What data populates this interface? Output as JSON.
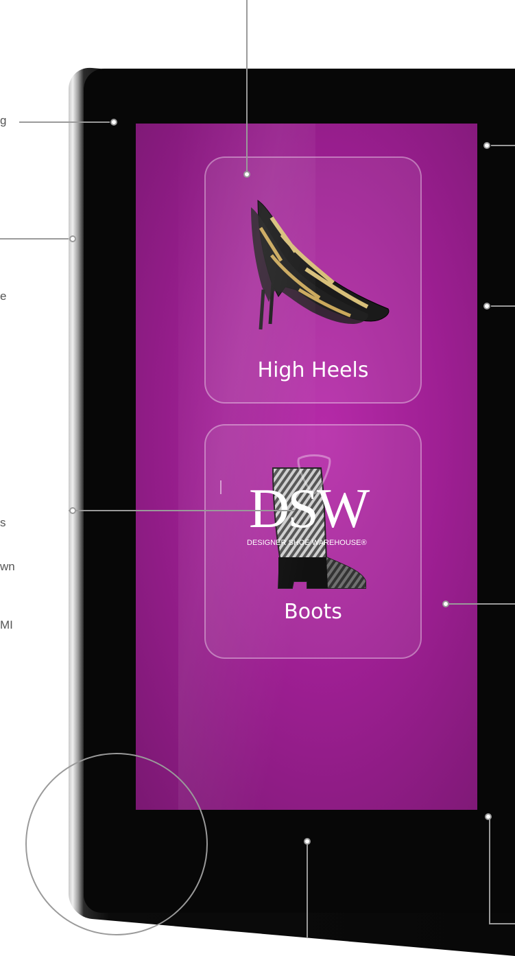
{
  "callout_fragments": [
    "g",
    "e",
    "s",
    "wn",
    "MI"
  ],
  "screen": {
    "cards": [
      {
        "label": "High Heels",
        "icon": "high-heel-shoe-icon"
      },
      {
        "label": "Boots",
        "icon": "boot-icon"
      }
    ],
    "nav_icon": "chevron-down-icon"
  },
  "brand": {
    "logo": "DSW",
    "tagline": "DESIGNER SHOE WAREHOUSE®"
  },
  "colors": {
    "screen_bg": "#9e1f93",
    "bezel": "#070707",
    "callout_line": "#9a9a9a"
  }
}
